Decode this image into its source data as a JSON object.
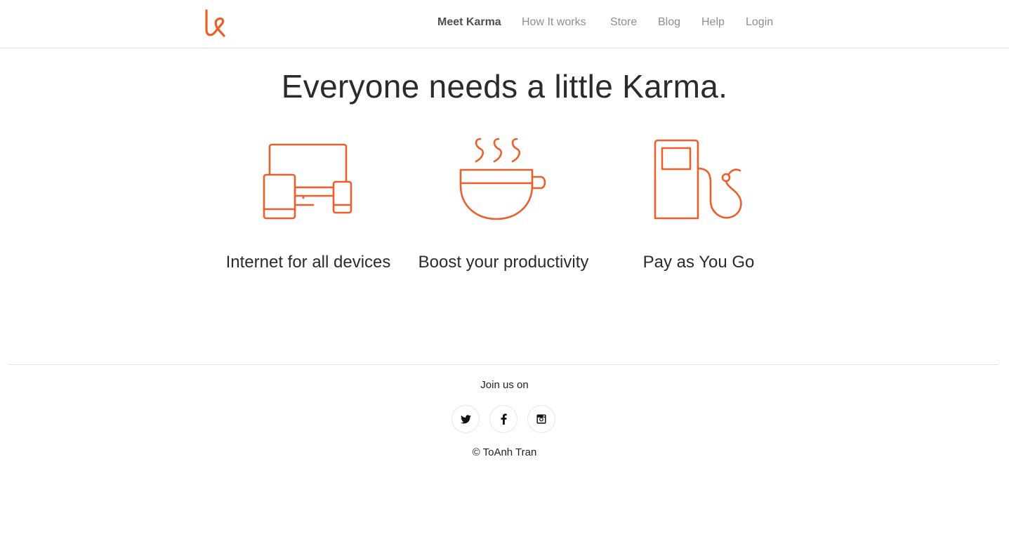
{
  "brand": {
    "accent_color": "#ec5f2a",
    "logo_icon": "karma-k-logo-icon"
  },
  "nav": {
    "items": [
      {
        "label": "Meet Karma",
        "active": true
      },
      {
        "label": "How It works",
        "active": false
      },
      {
        "label": "Store",
        "active": false
      },
      {
        "label": "Blog",
        "active": false
      },
      {
        "label": "Help",
        "active": false
      },
      {
        "label": "Login",
        "active": false
      }
    ]
  },
  "hero": {
    "headline": "Everyone needs a little Karma."
  },
  "features": [
    {
      "icon": "devices-icon",
      "label": "Internet for all devices"
    },
    {
      "icon": "coffee-cup-icon",
      "label": "Boost your productivity"
    },
    {
      "icon": "fuel-pump-icon",
      "label": "Pay as You Go"
    }
  ],
  "footer": {
    "join_text": "Join us on",
    "social": [
      {
        "icon": "twitter-icon"
      },
      {
        "icon": "facebook-icon"
      },
      {
        "icon": "instagram-icon"
      }
    ],
    "copyright": "© ToAnh Tran"
  }
}
